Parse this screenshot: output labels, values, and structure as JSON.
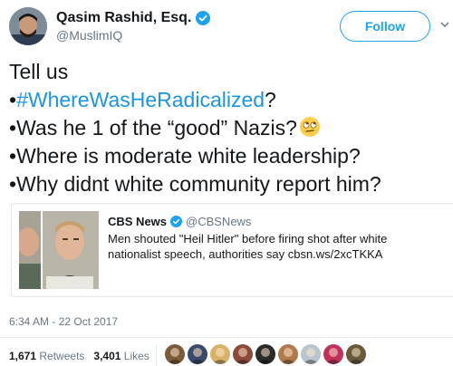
{
  "user": {
    "display_name": "Qasim Rashid, Esq.",
    "handle": "@MuslimIQ",
    "follow_label": "Follow"
  },
  "tweet": {
    "line1": "Tell us",
    "bullet": "•",
    "hashtag": "#WhereWasHeRadicalized",
    "hashtag_suffix": "?",
    "line3": "Was he 1 of the “good” Nazis?",
    "line4": "•Where is moderate white leadership?",
    "line5": "•Why didnt white community report him?"
  },
  "card": {
    "name": "CBS News",
    "handle": "@CBSNews",
    "text": "Men shouted \"Heil Hitler\" before firing shot after white nationalist speech, authorities say cbsn.ws/2xcTKKA"
  },
  "timestamp": "6:34 AM - 22 Oct 2017",
  "stats": {
    "retweets_count": "1,671",
    "retweets_label": "Retweets",
    "likes_count": "3,401",
    "likes_label": "Likes"
  },
  "likers": [
    "#7a5b3a",
    "#3a4a6a",
    "#d9b26a",
    "#8c4a3a",
    "#2a2a2a",
    "#b07a4a",
    "#b8c4d0",
    "#c0305a",
    "#6a5a3a"
  ],
  "colors": {
    "accent": "#1da1f2",
    "hashtag": "#1b95e0",
    "secondary_text": "#657786"
  }
}
